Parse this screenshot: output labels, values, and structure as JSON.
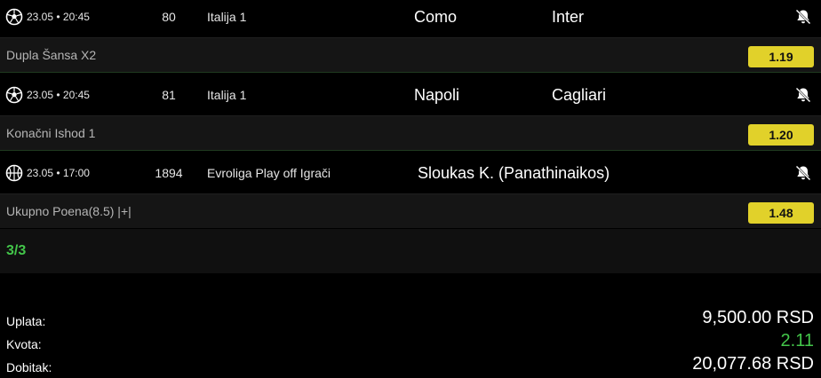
{
  "events": [
    {
      "sport_icon": "soccer-ball-icon",
      "datetime": "23.05 • 20:45",
      "code": "80",
      "league": "Italija 1",
      "home": "Como",
      "away": "Inter",
      "pick_label": "Dupla Šansa X2",
      "odds": "1.19"
    },
    {
      "sport_icon": "soccer-ball-icon",
      "datetime": "23.05 • 20:45",
      "code": "81",
      "league": "Italija 1",
      "home": "Napoli",
      "away": "Cagliari",
      "pick_label": "Konačni Ishod 1",
      "odds": "1.20"
    },
    {
      "sport_icon": "basketball-icon",
      "datetime": "23.05 • 17:00",
      "code": "1894",
      "league": "Evroliga Play off Igrači",
      "player": "Sloukas K. (Panathinaikos)",
      "pick_label": "Ukupno Poena(8.5) |+|",
      "odds": "1.48"
    }
  ],
  "count_label": "3/3",
  "summary": {
    "stake_label": "Uplata:",
    "stake_value": "9,500.00 RSD",
    "odds_label": "Kvota:",
    "odds_value": "2.11",
    "payout_label": "Dobitak:",
    "payout_value": "20,077.68 RSD"
  },
  "colors": {
    "odds_badge": "#e1d12a",
    "accent_green": "#43c64a",
    "pick_row_bg": "#151515"
  }
}
